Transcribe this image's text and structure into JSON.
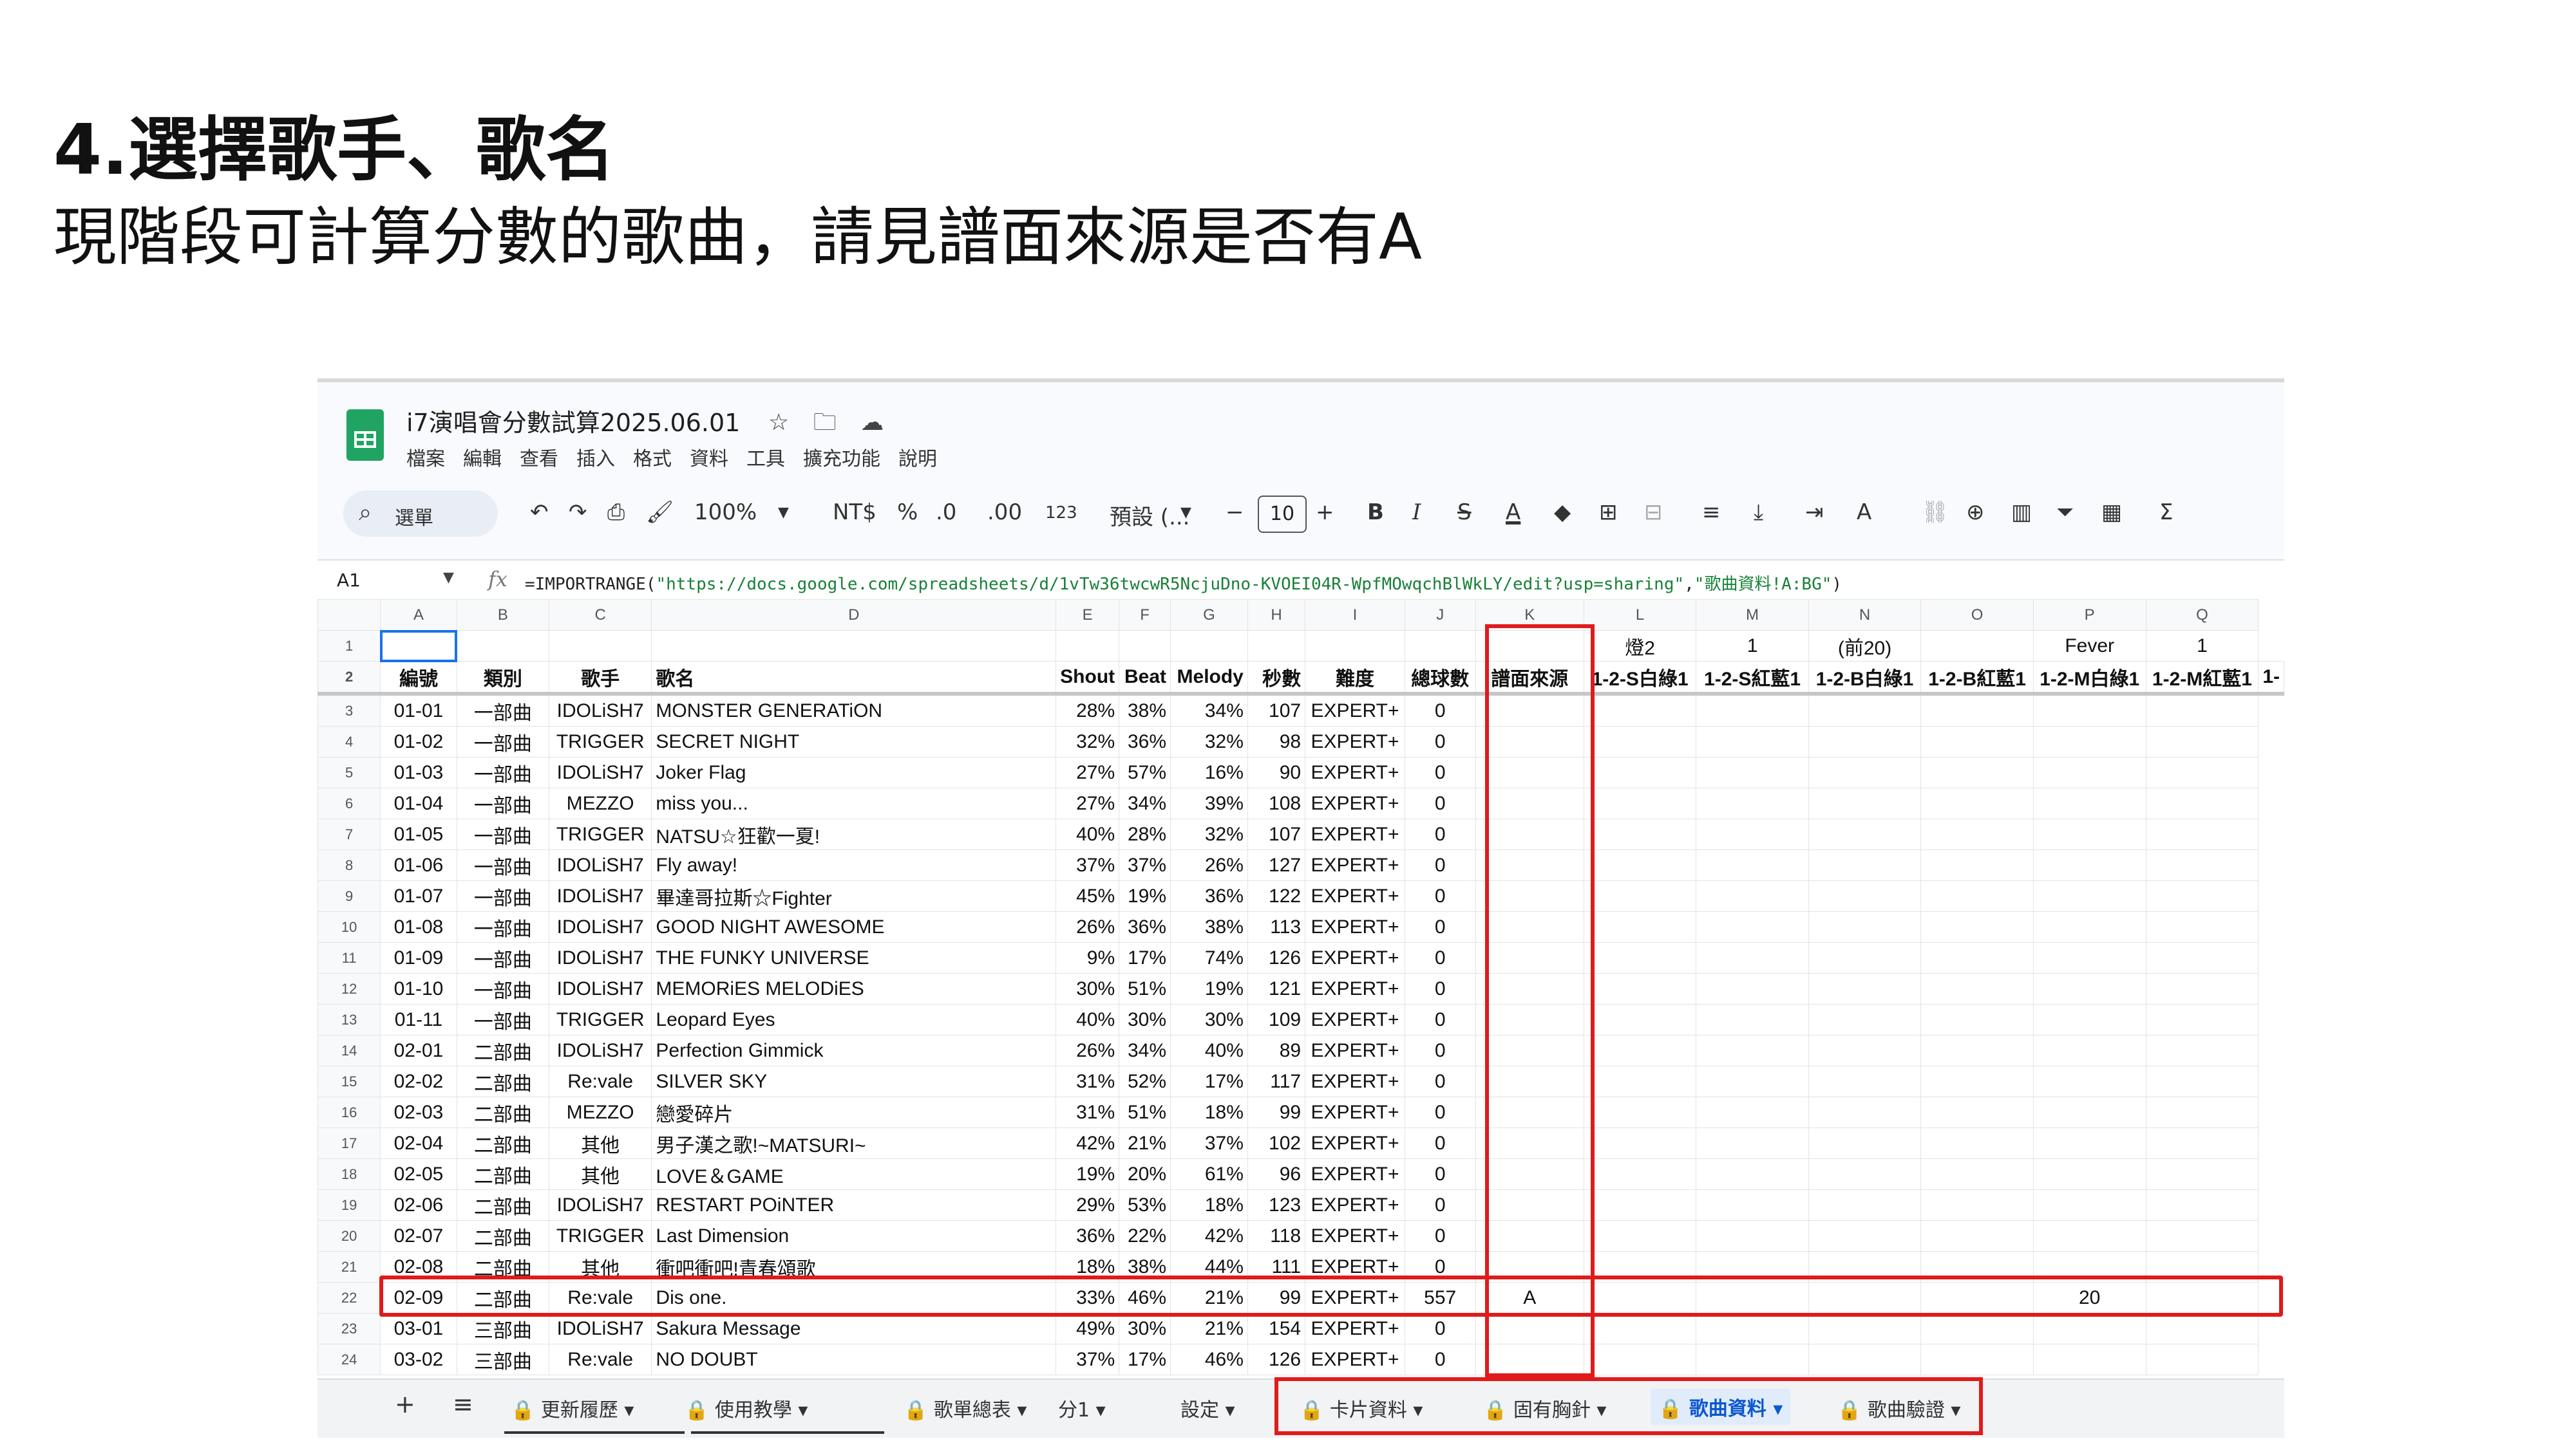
{
  "slide": {
    "title": "4.選擇歌手、歌名",
    "subtitle": "現階段可計算分數的歌曲，請見譜面來源是否有A"
  },
  "app": {
    "doc_title": "i7演唱會分數試算2025.06.01",
    "title_icons": [
      "star-icon",
      "folder-move-icon",
      "cloud-status-icon"
    ],
    "menu": [
      "檔案",
      "編輯",
      "查看",
      "插入",
      "格式",
      "資料",
      "工具",
      "擴充功能",
      "說明"
    ],
    "toolbar": {
      "search_label": "選單",
      "zoom": "100%",
      "currency": "NT$",
      "percent": "%",
      "dec_decrease": ".0",
      "dec_increase": ".00",
      "number_format": "123",
      "font": "預設 (...",
      "font_size": "10",
      "bold": "B",
      "italic": "I",
      "strike": "S",
      "text_color": "A"
    },
    "formula_bar": {
      "cell_ref": "A1",
      "fx": "fx",
      "formula_prefix": "=IMPORTRANGE(",
      "formula_url": "\"https://docs.google.com/spreadsheets/d/1vTw36twcwR5NcjuDno-KVOEI04R-WpfMOwqchBlWkLY/edit?usp=sharing\"",
      "formula_mid": ",",
      "formula_range": "\"歌曲資料!A:BG\"",
      "formula_suffix": ")"
    },
    "columns": [
      "A",
      "B",
      "C",
      "D",
      "E",
      "F",
      "G",
      "H",
      "I",
      "J",
      "K",
      "L",
      "M",
      "N",
      "O",
      "P",
      "Q"
    ],
    "row1": [
      "",
      "",
      "",
      "",
      "",
      "",
      "",
      "",
      "",
      "",
      "",
      "燈2",
      "1",
      "(前20)",
      "",
      "Fever",
      "1"
    ],
    "headers": [
      "編號",
      "類別",
      "歌手",
      "歌名",
      "Shout",
      "Beat",
      "Melody",
      "秒數",
      "難度",
      "總球數",
      "譜面來源",
      "1-2-S白綠1",
      "1-2-S紅藍1",
      "1-2-B白綠1",
      "1-2-B紅藍1",
      "1-2-M白綠1",
      "1-2-M紅藍1",
      "1-"
    ],
    "rows": [
      {
        "n": "3",
        "cells": [
          "01-01",
          "一部曲",
          "IDOLiSH7",
          "MONSTER GENERATiON",
          "28%",
          "38%",
          "34%",
          "107",
          "EXPERT+",
          "0",
          "",
          "",
          "",
          "",
          "",
          "",
          ""
        ]
      },
      {
        "n": "4",
        "cells": [
          "01-02",
          "一部曲",
          "TRIGGER",
          "SECRET NIGHT",
          "32%",
          "36%",
          "32%",
          "98",
          "EXPERT+",
          "0",
          "",
          "",
          "",
          "",
          "",
          "",
          ""
        ]
      },
      {
        "n": "5",
        "cells": [
          "01-03",
          "一部曲",
          "IDOLiSH7",
          "Joker Flag",
          "27%",
          "57%",
          "16%",
          "90",
          "EXPERT+",
          "0",
          "",
          "",
          "",
          "",
          "",
          "",
          ""
        ]
      },
      {
        "n": "6",
        "cells": [
          "01-04",
          "一部曲",
          "MEZZO",
          "miss you...",
          "27%",
          "34%",
          "39%",
          "108",
          "EXPERT+",
          "0",
          "",
          "",
          "",
          "",
          "",
          "",
          ""
        ]
      },
      {
        "n": "7",
        "cells": [
          "01-05",
          "一部曲",
          "TRIGGER",
          "NATSU☆狂歡一夏!",
          "40%",
          "28%",
          "32%",
          "107",
          "EXPERT+",
          "0",
          "",
          "",
          "",
          "",
          "",
          "",
          ""
        ]
      },
      {
        "n": "8",
        "cells": [
          "01-06",
          "一部曲",
          "IDOLiSH7",
          "Fly away!",
          "37%",
          "37%",
          "26%",
          "127",
          "EXPERT+",
          "0",
          "",
          "",
          "",
          "",
          "",
          "",
          ""
        ]
      },
      {
        "n": "9",
        "cells": [
          "01-07",
          "一部曲",
          "IDOLiSH7",
          "畢達哥拉斯☆Fighter",
          "45%",
          "19%",
          "36%",
          "122",
          "EXPERT+",
          "0",
          "",
          "",
          "",
          "",
          "",
          "",
          ""
        ]
      },
      {
        "n": "10",
        "cells": [
          "01-08",
          "一部曲",
          "IDOLiSH7",
          "GOOD NIGHT AWESOME",
          "26%",
          "36%",
          "38%",
          "113",
          "EXPERT+",
          "0",
          "",
          "",
          "",
          "",
          "",
          "",
          ""
        ]
      },
      {
        "n": "11",
        "cells": [
          "01-09",
          "一部曲",
          "IDOLiSH7",
          "THE FUNKY UNIVERSE",
          "9%",
          "17%",
          "74%",
          "126",
          "EXPERT+",
          "0",
          "",
          "",
          "",
          "",
          "",
          "",
          ""
        ]
      },
      {
        "n": "12",
        "cells": [
          "01-10",
          "一部曲",
          "IDOLiSH7",
          "MEMORiES MELODiES",
          "30%",
          "51%",
          "19%",
          "121",
          "EXPERT+",
          "0",
          "",
          "",
          "",
          "",
          "",
          "",
          ""
        ]
      },
      {
        "n": "13",
        "cells": [
          "01-11",
          "一部曲",
          "TRIGGER",
          "Leopard Eyes",
          "40%",
          "30%",
          "30%",
          "109",
          "EXPERT+",
          "0",
          "",
          "",
          "",
          "",
          "",
          "",
          ""
        ]
      },
      {
        "n": "14",
        "cells": [
          "02-01",
          "二部曲",
          "IDOLiSH7",
          "Perfection Gimmick",
          "26%",
          "34%",
          "40%",
          "89",
          "EXPERT+",
          "0",
          "",
          "",
          "",
          "",
          "",
          "",
          ""
        ]
      },
      {
        "n": "15",
        "cells": [
          "02-02",
          "二部曲",
          "Re:vale",
          "SILVER SKY",
          "31%",
          "52%",
          "17%",
          "117",
          "EXPERT+",
          "0",
          "",
          "",
          "",
          "",
          "",
          "",
          ""
        ]
      },
      {
        "n": "16",
        "cells": [
          "02-03",
          "二部曲",
          "MEZZO",
          "戀愛碎片",
          "31%",
          "51%",
          "18%",
          "99",
          "EXPERT+",
          "0",
          "",
          "",
          "",
          "",
          "",
          "",
          ""
        ]
      },
      {
        "n": "17",
        "cells": [
          "02-04",
          "二部曲",
          "其他",
          "男子漢之歌!~MATSURI~",
          "42%",
          "21%",
          "37%",
          "102",
          "EXPERT+",
          "0",
          "",
          "",
          "",
          "",
          "",
          "",
          ""
        ]
      },
      {
        "n": "18",
        "cells": [
          "02-05",
          "二部曲",
          "其他",
          "LOVE＆GAME",
          "19%",
          "20%",
          "61%",
          "96",
          "EXPERT+",
          "0",
          "",
          "",
          "",
          "",
          "",
          "",
          ""
        ]
      },
      {
        "n": "19",
        "cells": [
          "02-06",
          "二部曲",
          "IDOLiSH7",
          "RESTART POiNTER",
          "29%",
          "53%",
          "18%",
          "123",
          "EXPERT+",
          "0",
          "",
          "",
          "",
          "",
          "",
          "",
          ""
        ]
      },
      {
        "n": "20",
        "cells": [
          "02-07",
          "二部曲",
          "TRIGGER",
          "Last Dimension",
          "36%",
          "22%",
          "42%",
          "118",
          "EXPERT+",
          "0",
          "",
          "",
          "",
          "",
          "",
          "",
          ""
        ]
      },
      {
        "n": "21",
        "cells": [
          "02-08",
          "二部曲",
          "其他",
          "衝吧衝吧!青春頌歌",
          "18%",
          "38%",
          "44%",
          "111",
          "EXPERT+",
          "0",
          "",
          "",
          "",
          "",
          "",
          "",
          ""
        ]
      },
      {
        "n": "22",
        "cells": [
          "02-09",
          "二部曲",
          "Re:vale",
          "Dis one.",
          "33%",
          "46%",
          "21%",
          "99",
          "EXPERT+",
          "557",
          "A",
          "",
          "",
          "",
          "",
          "20",
          ""
        ]
      },
      {
        "n": "23",
        "cells": [
          "03-01",
          "三部曲",
          "IDOLiSH7",
          "Sakura Message",
          "49%",
          "30%",
          "21%",
          "154",
          "EXPERT+",
          "0",
          "",
          "",
          "",
          "",
          "",
          "",
          ""
        ]
      },
      {
        "n": "24",
        "cells": [
          "03-02",
          "三部曲",
          "Re:vale",
          "NO DOUBT",
          "37%",
          "17%",
          "46%",
          "126",
          "EXPERT+",
          "0",
          "",
          "",
          "",
          "",
          "",
          "",
          ""
        ]
      }
    ],
    "tabs": [
      {
        "label": "更新履歷",
        "locked": true
      },
      {
        "label": "使用教學",
        "locked": true
      },
      {
        "label": "歌單總表",
        "locked": true
      },
      {
        "label": "分1",
        "locked": false
      },
      {
        "label": "設定",
        "locked": false
      },
      {
        "label": "卡片資料",
        "locked": true
      },
      {
        "label": "固有胸針",
        "locked": true
      },
      {
        "label": "歌曲資料",
        "locked": true,
        "active": true
      },
      {
        "label": "歌曲驗證",
        "locked": true
      }
    ],
    "highlight_color": "#e01b1b",
    "accent_color": "#0b57d0"
  }
}
